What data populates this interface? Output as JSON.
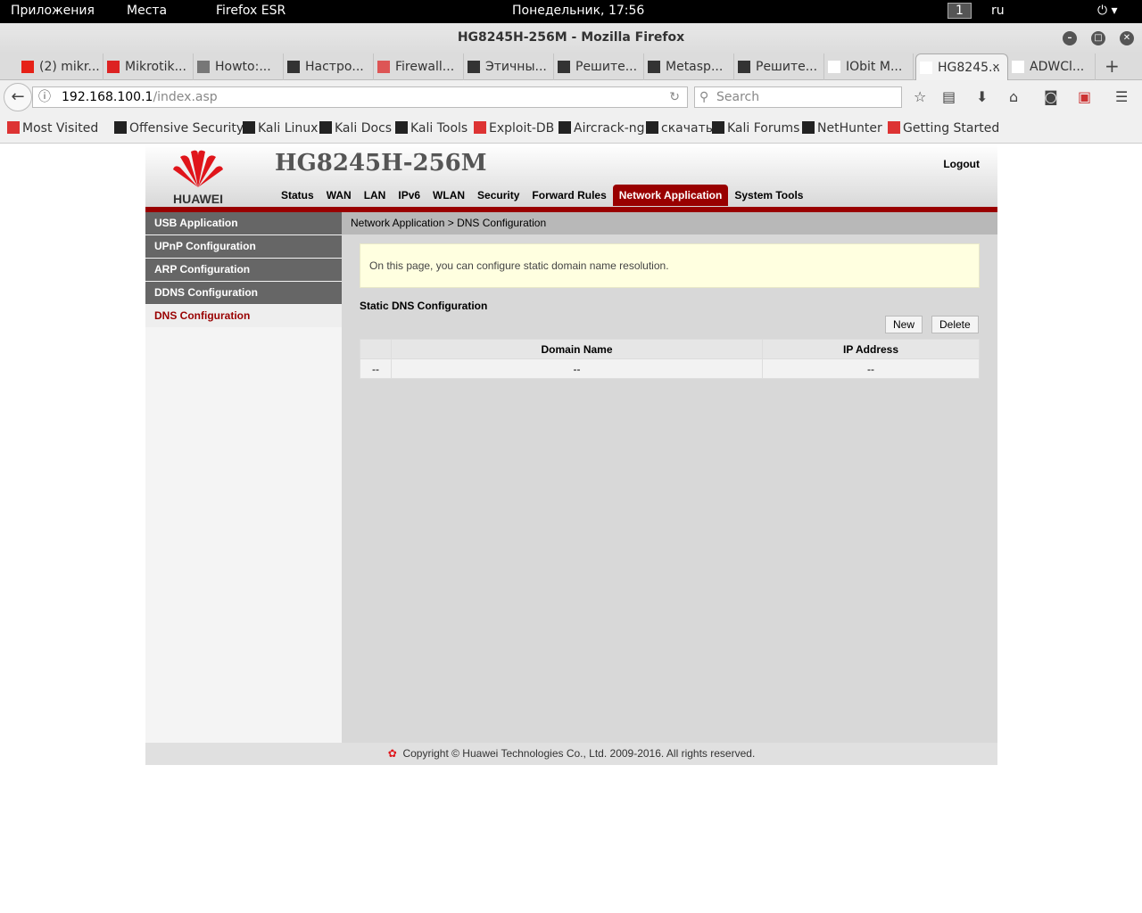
{
  "system": {
    "apps": "Приложения",
    "places": "Места",
    "app": "Firefox ESR",
    "clock": "Понедельник, 17:56",
    "workspace": "1",
    "lang": "ru"
  },
  "window": {
    "title": "HG8245H-256M - Mozilla Firefox"
  },
  "tabs": [
    {
      "label": "(2) mikr...",
      "color": "#e62117"
    },
    {
      "label": "Mikrotik...",
      "color": "#d22"
    },
    {
      "label": "Howto:...",
      "color": "#777"
    },
    {
      "label": "Настро...",
      "color": "#333"
    },
    {
      "label": "Firewall...",
      "color": "#d55"
    },
    {
      "label": "Этичны...",
      "color": "#333"
    },
    {
      "label": "Решите...",
      "color": "#333"
    },
    {
      "label": "Metasp...",
      "color": "#333"
    },
    {
      "label": "Решите...",
      "color": "#333"
    },
    {
      "label": "IObit M...",
      "color": "#fff"
    },
    {
      "label": "HG8245...",
      "color": "#fff"
    },
    {
      "label": "ADWCl...",
      "color": "#fff"
    }
  ],
  "nav": {
    "url_host": "192.168.100.1",
    "url_path": "/index.asp",
    "search_placeholder": "Search"
  },
  "bookmarks": [
    "Most Visited",
    "Offensive Security",
    "Kali Linux",
    "Kali Docs",
    "Kali Tools",
    "Exploit-DB",
    "Aircrack-ng",
    "скачать",
    "Kali Forums",
    "NetHunter",
    "Getting Started"
  ],
  "router": {
    "brand": "HUAWEI",
    "model": "HG8245H-256M",
    "logout": "Logout",
    "menu": [
      "Status",
      "WAN",
      "LAN",
      "IPv6",
      "WLAN",
      "Security",
      "Forward Rules",
      "Network Application",
      "System Tools"
    ],
    "sidebar": [
      "USB Application",
      "UPnP Configuration",
      "ARP Configuration",
      "DDNS Configuration",
      "DNS Configuration"
    ],
    "breadcrumb": "Network Application > DNS Configuration",
    "info": "On this page, you can configure static domain name resolution.",
    "section": "Static DNS Configuration",
    "new": "New",
    "delete": "Delete",
    "columns": [
      "",
      "Domain Name",
      "IP Address"
    ],
    "row": [
      "--",
      "--",
      "--"
    ],
    "footer": "Copyright © Huawei Technologies Co., Ltd. 2009-2016. All rights reserved."
  }
}
